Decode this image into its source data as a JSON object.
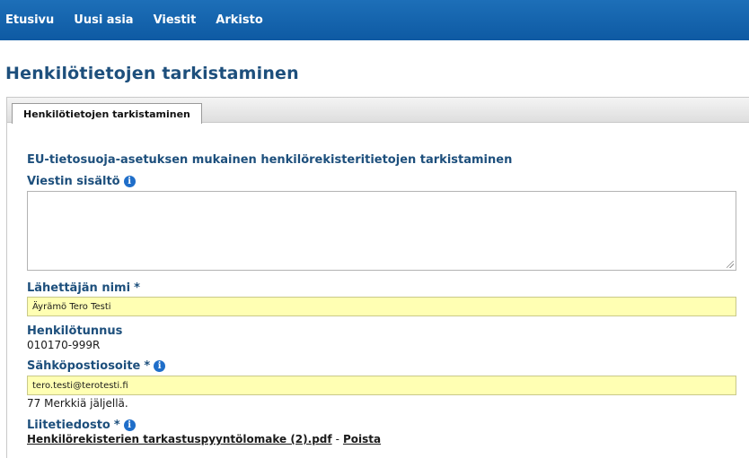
{
  "nav": {
    "items": [
      "Etusivu",
      "Uusi asia",
      "Viestit",
      "Arkisto"
    ]
  },
  "page": {
    "title": "Henkilötietojen tarkistaminen"
  },
  "tab": {
    "label": "Henkilötietojen tarkistaminen"
  },
  "form": {
    "section_title": "EU-tietosuoja-asetuksen mukainen henkilörekisteritietojen tarkistaminen",
    "message": {
      "label": "Viestin sisältö",
      "value": ""
    },
    "sender_name": {
      "label": "Lähettäjän nimi",
      "required_mark": "*",
      "value": "Äyrämö Tero Testi"
    },
    "personal_id": {
      "label": "Henkilötunnus",
      "value": "010170-999R"
    },
    "email": {
      "label": "Sähköpostiosoite",
      "required_mark": "*",
      "value": "tero.testi@terotesti.fi",
      "chars_left": "77 Merkkiä jäljellä."
    },
    "attachment": {
      "label": "Liitetiedosto",
      "required_mark": "*",
      "file_name": "Henkilörekisterien tarkastuspyyntölomake (2).pdf",
      "separator": "-",
      "remove_label": "Poista"
    },
    "info_icon_glyph": "i"
  },
  "colors": {
    "nav_bar": "#1565b0",
    "heading": "#1d4f7c",
    "input_highlight": "#ffffb3",
    "info_icon": "#1f6ec9"
  },
  "icons": [
    "info-icon"
  ]
}
